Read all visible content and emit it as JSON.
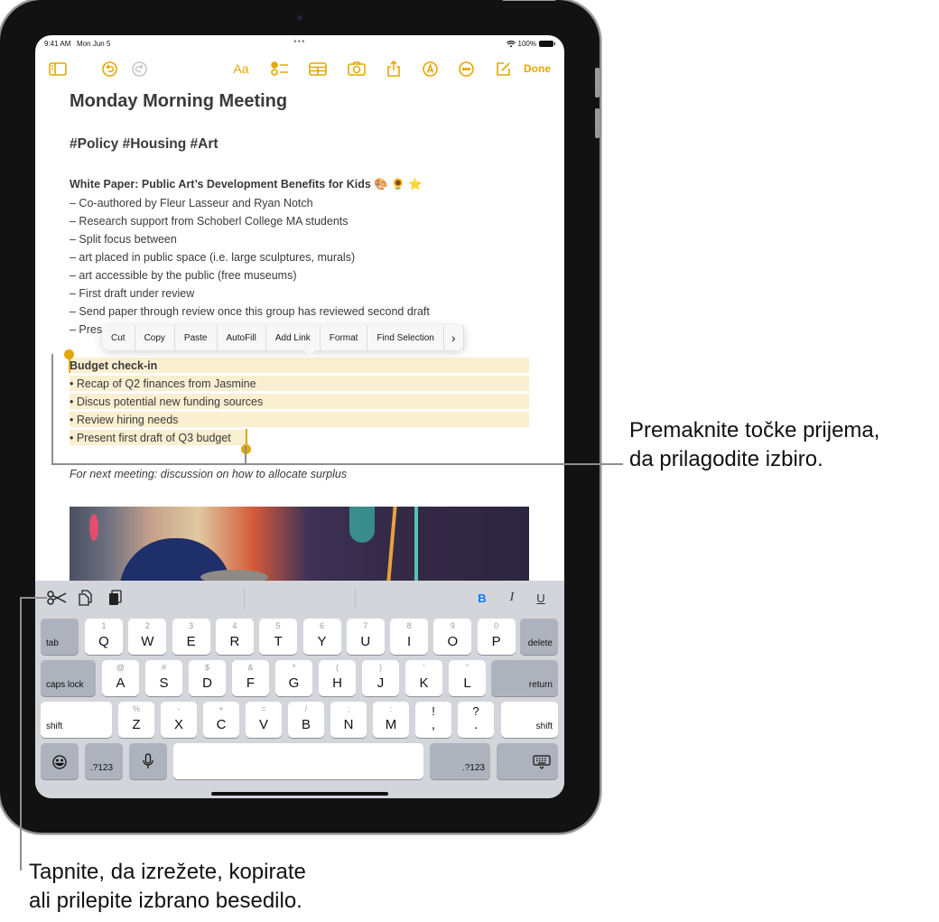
{
  "status_bar": {
    "time": "9:41 AM",
    "date": "Mon Jun 5",
    "battery": "100%"
  },
  "toolbar": {
    "icons": [
      "sidebar-icon",
      "undo-icon",
      "redo-icon",
      "text-format-icon",
      "checklist-icon",
      "table-icon",
      "camera-icon",
      "share-icon",
      "markup-icon",
      "more-icon",
      "compose-icon"
    ],
    "format_label": "Aa",
    "done_label": "Done",
    "accent_color": "#e6a700"
  },
  "note": {
    "title": "Monday Morning Meeting",
    "tags": "#Policy #Housing #Art",
    "section1_heading": "White Paper: Public Art’s Development Benefits for Kids",
    "section1_emoji": "🎨 🌻 ⭐",
    "section1_lines": [
      "– Co-authored by Fleur Lasseur and Ryan Notch",
      "– Research support from Schoberl College MA students",
      "– Split focus between",
      "– art placed in public space (i.e. large sculptures, murals)",
      "– art accessible by the public (free museums)",
      "– First draft under review",
      "– Send paper through review once this group has reviewed second draft",
      "– Pres"
    ],
    "section2_heading": "Budget check-in",
    "section2_lines": [
      "• Recap of Q2 finances from Jasmine",
      "• Discus potential new funding sources",
      "• Review hiring needs",
      "• Present first draft of Q3 budget"
    ],
    "footer_line": "For next meeting: discussion on how to allocate surplus",
    "selection_color": "#faefd0"
  },
  "context_menu": {
    "items": [
      "Cut",
      "Copy",
      "Paste",
      "AutoFill",
      "Add Link",
      "Format",
      "Find Selection"
    ],
    "more": "›"
  },
  "keyboard": {
    "shortcut_bar": {
      "cut_icon": "scissors-icon",
      "copy_icon": "copy-icon",
      "paste_icon": "paste-icon",
      "bold": "B",
      "italic": "I",
      "underline": "U"
    },
    "row1": {
      "left": "tab",
      "keys": [
        [
          "1",
          "Q"
        ],
        [
          "2",
          "W"
        ],
        [
          "3",
          "E"
        ],
        [
          "4",
          "R"
        ],
        [
          "5",
          "T"
        ],
        [
          "6",
          "Y"
        ],
        [
          "7",
          "U"
        ],
        [
          "8",
          "I"
        ],
        [
          "9",
          "O"
        ],
        [
          "0",
          "P"
        ]
      ],
      "right": "delete"
    },
    "row2": {
      "left": "caps lock",
      "keys": [
        [
          "@",
          "A"
        ],
        [
          "#",
          "S"
        ],
        [
          "$",
          "D"
        ],
        [
          "&",
          "F"
        ],
        [
          "*",
          "G"
        ],
        [
          "(",
          "H"
        ],
        [
          ")",
          "J"
        ],
        [
          "’",
          "K"
        ],
        [
          "\"",
          "L"
        ]
      ],
      "right": "return"
    },
    "row3": {
      "left": "shift",
      "keys": [
        [
          "%",
          "Z"
        ],
        [
          "-",
          "X"
        ],
        [
          "+",
          "C"
        ],
        [
          "=",
          "V"
        ],
        [
          "/",
          "B"
        ],
        [
          ";",
          "N"
        ],
        [
          ":",
          "M"
        ],
        [
          "!",
          ","
        ],
        [
          "?",
          "."
        ]
      ],
      "right": "shift"
    },
    "row4": {
      "emoji_icon": "emoji-icon",
      "numbers_left": ".?123",
      "mic_icon": "microphone-icon",
      "numbers_right": ".?123",
      "dismiss_icon": "keyboard-dismiss-icon"
    }
  },
  "callouts": {
    "right": [
      "Premaknite točke prijema,",
      "da prilagodite izbiro."
    ],
    "bottom": [
      "Tapnite, da izrežete, kopirate",
      "ali prilepite izbrano besedilo."
    ]
  }
}
